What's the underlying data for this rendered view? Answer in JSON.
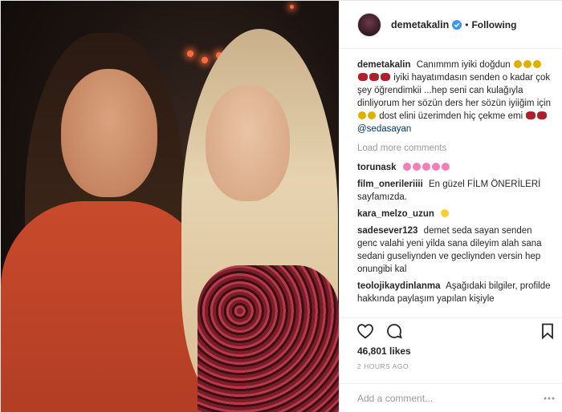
{
  "header": {
    "username": "demetakalin",
    "separator": "•",
    "follow_label": "Following"
  },
  "caption": {
    "username": "demetakalin",
    "text_part1": "Canımmm iyiki doğdun",
    "text_part2": "iyiki hayatımdasın",
    "text_part3": "senden o kadar çok şey öğrendimkii ...hep seni can kulağıyla dinliyorum her sözün ders her sözün iyiiğim için",
    "text_part4": "dost elini üzerimden hiç çekme emi",
    "mention": "@sedasayan"
  },
  "load_more": "Load more comments",
  "comments": [
    {
      "username": "torunask",
      "text": ""
    },
    {
      "username": "film_onerileriiii",
      "text": "En güzel FİLM ÖNERİLERİ sayfamızda."
    },
    {
      "username": "kara_melzo_uzun",
      "text": ""
    },
    {
      "username": "sadesever123",
      "text": "demet seda sayan senden genc valahi yeni yilda sana dileyim alah sana sedani guseliynden ve gecliynden versin hep onungibi kal"
    },
    {
      "username": "teolojikaydinlanma",
      "text": "Aşağıdaki bilgiler, profilde hakkında paylaşım yapılan kişiyle"
    }
  ],
  "likes": "46,801 likes",
  "timestamp": "2 HOURS AGO",
  "add_comment": {
    "placeholder": "Add a comment..."
  },
  "icons": {
    "verified": "verified-badge-icon",
    "like": "heart-icon",
    "comment": "comment-bubble-icon",
    "save": "bookmark-icon",
    "more": "more-dots-icon"
  },
  "colors": {
    "verified_blue": "#3897f0",
    "text": "#262626",
    "muted": "#999999",
    "mention": "#003569"
  }
}
